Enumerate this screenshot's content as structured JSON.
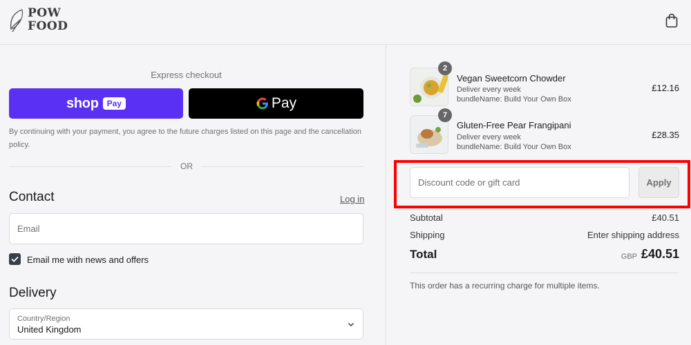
{
  "header": {
    "logo_line1": "POW",
    "logo_line2": "FOOD",
    "cart_icon": "shopping-bag-icon"
  },
  "express": {
    "title": "Express checkout",
    "shop_word": "shop",
    "shop_pay": "Pay",
    "gpay_g": "G",
    "gpay_word": "Pay",
    "disclaimer": "By continuing with your payment, you agree to the future charges listed on this page and the cancellation policy.",
    "or_text": "OR"
  },
  "contact": {
    "title": "Contact",
    "login_label": "Log in",
    "email_placeholder": "Email",
    "newsletter_label": "Email me with news and offers",
    "newsletter_checked": true
  },
  "delivery": {
    "title": "Delivery",
    "country_label": "Country/Region",
    "country_value": "United Kingdom"
  },
  "order": {
    "items": [
      {
        "name": "Vegan Sweetcorn Chowder",
        "frequency": "Deliver every week",
        "bundle": "bundleName: Build Your Own Box",
        "quantity": "2",
        "price": "£12.16"
      },
      {
        "name": "Gluten-Free Pear Frangipani",
        "frequency": "Deliver every week",
        "bundle": "bundleName: Build Your Own Box",
        "quantity": "7",
        "price": "£28.35"
      }
    ],
    "discount_placeholder": "Discount code or gift card",
    "apply_label": "Apply",
    "subtotal_label": "Subtotal",
    "subtotal_value": "£40.51",
    "shipping_label": "Shipping",
    "shipping_value": "Enter shipping address",
    "total_label": "Total",
    "total_currency": "GBP",
    "total_value": "£40.51",
    "recurring_note": "This order has a recurring charge for multiple items."
  },
  "colors": {
    "shop_pay_purple": "#5a31f4",
    "gpay_black": "#000000",
    "highlight_red": "#ff0000"
  }
}
